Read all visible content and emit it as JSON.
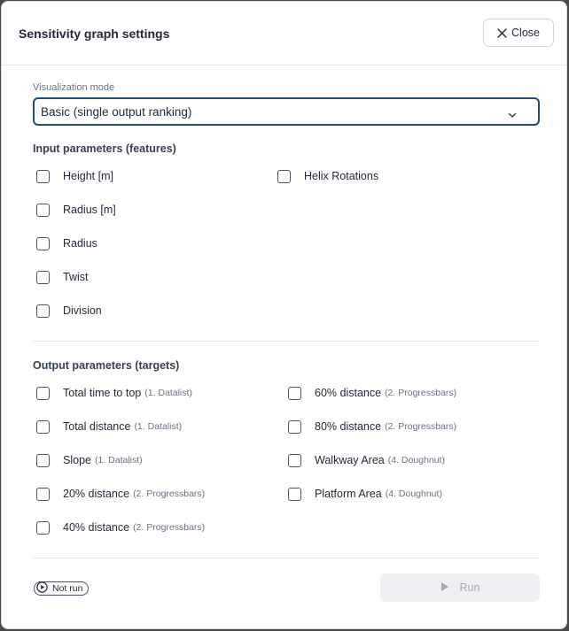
{
  "dialog": {
    "title": "Sensitivity graph settings",
    "close_label": "Close"
  },
  "visualization": {
    "label": "Visualization mode",
    "selected": "Basic (single output ranking)"
  },
  "inputs": {
    "title": "Input parameters (features)",
    "items": [
      {
        "label": "Height [m]",
        "checked": false
      },
      {
        "label": "Radius [m]",
        "checked": false
      },
      {
        "label": "Radius",
        "checked": false
      },
      {
        "label": "Twist",
        "checked": false
      },
      {
        "label": "Division",
        "checked": false
      },
      {
        "label": "Helix Rotations",
        "checked": false
      }
    ]
  },
  "outputs": {
    "title": "Output parameters (targets)",
    "items": [
      {
        "label": "Total time to top",
        "tag": "(1. Datalist)",
        "checked": false
      },
      {
        "label": "Total distance",
        "tag": "(1. Datalist)",
        "checked": false
      },
      {
        "label": "Slope",
        "tag": "(1. Datalist)",
        "checked": false
      },
      {
        "label": "20% distance",
        "tag": "(2. Progressbars)",
        "checked": false
      },
      {
        "label": "40% distance",
        "tag": "(2. Progressbars)",
        "checked": false
      },
      {
        "label": "60% distance",
        "tag": "(2. Progressbars)",
        "checked": false
      },
      {
        "label": "80% distance",
        "tag": "(2. Progressbars)",
        "checked": false
      },
      {
        "label": "Walkway Area",
        "tag": "(4. Doughnut)",
        "checked": false
      },
      {
        "label": "Platform Area",
        "tag": "(4. Doughnut)",
        "checked": false
      }
    ]
  },
  "footer": {
    "status": "Not run",
    "run_label": "Run",
    "run_disabled": true
  },
  "icons": {
    "close": "close-icon",
    "dropdown": "chevron-down-icon",
    "status": "play-circle-icon",
    "run": "play-icon"
  },
  "colors": {
    "select_border": "#1f4b7a",
    "run_disabled_bg": "#eef0f3",
    "run_disabled_text": "#a4a9b1"
  }
}
